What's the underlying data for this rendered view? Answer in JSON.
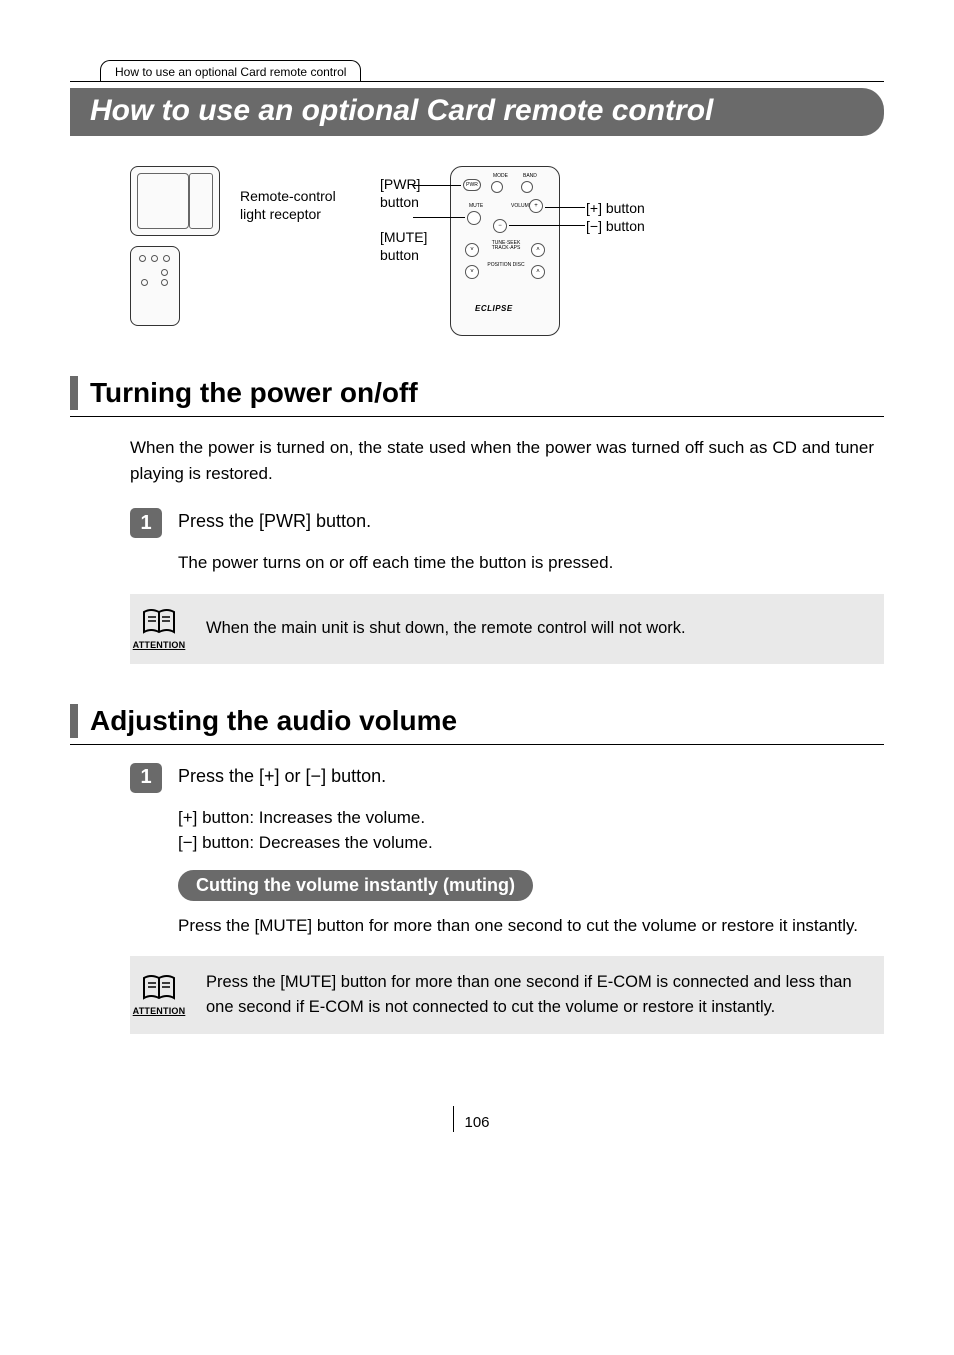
{
  "header": {
    "tab": "How to use an optional Card remote control",
    "title": "How to use an optional Card remote control"
  },
  "diagram": {
    "receptor_label": "Remote-control light receptor",
    "pwr_label": "[PWR] button",
    "mute_label": "[MUTE] button",
    "plus_label": "[+] button",
    "minus_label": "[−] button",
    "remote_legend": {
      "mode": "MODE",
      "band": "BAND",
      "mute": "MUTE",
      "volume": "VOLUME",
      "pwr": "PWR",
      "tune": "TUNE·SEEK TRACK·APS",
      "pos": "POSITION DISC"
    }
  },
  "section1": {
    "title": "Turning the power on/off",
    "intro": "When the power is turned on, the state used when the power was turned off such as CD and tuner playing is restored.",
    "step1_num": "1",
    "step1_label": "Press the [PWR] button.",
    "step1_sub": "The power turns on or off each time the button is pressed.",
    "attention_label": "ATTENTION",
    "attention_text": "When the main unit is shut down, the remote control will not work."
  },
  "section2": {
    "title": "Adjusting the audio volume",
    "step1_num": "1",
    "step1_label": "Press the [+] or [−] button.",
    "plus_line": "[+] button:  Increases the volume.",
    "minus_line": "[−] button:  Decreases the volume.",
    "sub_title": "Cutting the volume instantly (muting)",
    "sub_body": "Press the [MUTE] button for more than one second to cut the volume or restore it instantly.",
    "attention_label": "ATTENTION",
    "attention_text": "Press the [MUTE] button for more than one second if E-COM is connected and less than one second if E-COM is not connected to cut the volume or restore it instantly."
  },
  "page_number": "106"
}
